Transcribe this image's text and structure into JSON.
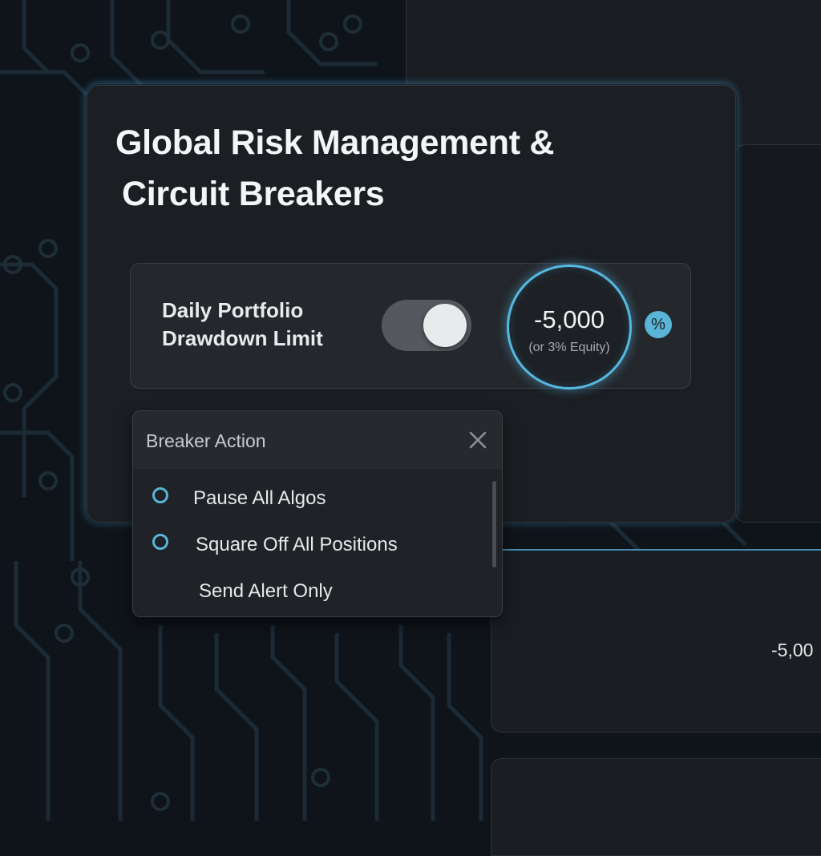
{
  "card": {
    "title_line1": "Global Risk Management &",
    "title_line2": "Circuit Breakers"
  },
  "drawdown": {
    "label_line1": "Daily Portfolio",
    "label_line2": "Drawdown Limit",
    "toggle_on": true,
    "value": "-5,000",
    "sub": "(or 3% Equity)",
    "unit_badge": "%"
  },
  "breaker_action": {
    "title": "Breaker Action",
    "close_icon": "close-icon",
    "options": [
      {
        "label": "Pause All Algos",
        "radio": true
      },
      {
        "label": "Square Off All Positions",
        "radio": true
      },
      {
        "label": "Send Alert Only",
        "radio": false
      }
    ]
  },
  "background_panel": {
    "value": "-5,00"
  },
  "colors": {
    "accent": "#5ab4d6",
    "background": "#0f141a",
    "card": "#1b1e22"
  }
}
